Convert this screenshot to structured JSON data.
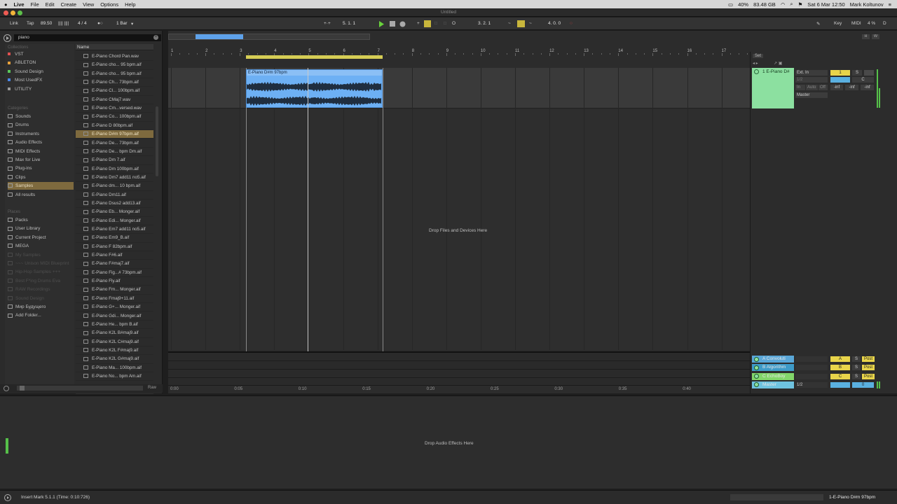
{
  "menubar": {
    "items": [
      "Live",
      "File",
      "Edit",
      "Create",
      "View",
      "Options",
      "Help"
    ],
    "battery": "40%",
    "disk": "83.48 GB",
    "clock": "Sat 6 Mar 12:50",
    "user": "Mark Koltunov"
  },
  "window": {
    "title": "Untitled"
  },
  "control": {
    "link": "Link",
    "tap": "Tap",
    "tempo": "89.50",
    "signature": "4 / 4",
    "quantize": "1 Bar",
    "position": "5. 1. 1",
    "loop_start": "3. 2. 1",
    "loop_length": "4. 0. 0",
    "key": "Key",
    "midi": "MIDI",
    "cpu": "4 %",
    "disk_indicator": "D"
  },
  "browser": {
    "search": "piano",
    "collections_header": "Collections",
    "collections": [
      {
        "label": "VST",
        "color": "#e05050"
      },
      {
        "label": "ABLETON",
        "color": "#e8a23a"
      },
      {
        "label": "Sound Design",
        "color": "#5ac85a"
      },
      {
        "label": "Most UsedFX",
        "color": "#4a86e8"
      },
      {
        "label": "UTILITY",
        "color": "#9a9a9a"
      }
    ],
    "categories_header": "Categories",
    "categories": [
      "Sounds",
      "Drums",
      "Instruments",
      "Audio Effects",
      "MIDI Effects",
      "Max for Live",
      "Plug-ins",
      "Clips",
      "Samples",
      "All results"
    ],
    "selected_category": "Samples",
    "places_header": "Places",
    "places": [
      {
        "label": "Packs",
        "dim": false
      },
      {
        "label": "User Library",
        "dim": false
      },
      {
        "label": "Current Project",
        "dim": false
      },
      {
        "label": "MEGA",
        "dim": false
      },
      {
        "label": "My Samples",
        "dim": true
      },
      {
        "label": "~~~ Unison MIDI Blueprint",
        "dim": true
      },
      {
        "label": "Hip-Hop Samples +++",
        "dim": true
      },
      {
        "label": "Best F*ing Drums Eva",
        "dim": true
      },
      {
        "label": "RAW Recordings",
        "dim": true
      },
      {
        "label": "Sound Design",
        "dim": true
      },
      {
        "label": "Мир Будущего",
        "dim": false
      },
      {
        "label": "Add Folder...",
        "dim": false
      }
    ],
    "name_header": "Name",
    "files": [
      "E-Piano Chord Pan.wav",
      "E-Piano cho... 95 bpm.aif",
      "E-Piano cho... 95 bpm.aif",
      "E-Piano Ch... 73bpm.aif",
      "E-Piano Cl... 100bpm.aif",
      "E-Piano CMaj7.wav",
      "E-Piano Cm...versed.wav",
      "E-Piano Co... 100bpm.aif",
      "E-Piano D 80bpm.aif",
      "E-Piano D#m 97bpm.aif",
      "E-Piano De... 73bpm.aif",
      "E-Piano De... bpm Dm.aif",
      "E-Piano Dm 7.aif",
      "E-Piano Dm 100bpm.aif",
      "E-Piano Dm7 add11 no5.aif",
      "E-Piano dm... 10 bpm.aif",
      "E-Piano Dm11.aif",
      "E-Piano Dsus2 add13.aif",
      "E-Piano Eb... Monger.aif",
      "E-Piano Edi... Monger.aif",
      "E-Piano Em7 add11 no5.aif",
      "E-Piano Em9_B.aif",
      "E-Piano F 82bpm.aif",
      "E-Piano F#6.aif",
      "E-Piano F#maj7.aif",
      "E-Piano Fig...# 73bpm.aif",
      "E-Piano Fly.aif",
      "E-Piano Fm... Monger.aif",
      "E-Piano Fmaj9+11.aif",
      "E-Piano G+... Monger.aif",
      "E-Piano Gdi... Monger.aif",
      "E-Piano He... bpm B.aif",
      "E-Piano K2L B#maj9.aif",
      "E-Piano K2L C#maj9.aif",
      "E-Piano K2L F#maj9.aif",
      "E-Piano K2L G#maj9.aif",
      "E-Piano Ma... 100bpm.aif",
      "E-Piano No... bpm Am.aif"
    ],
    "selected_file": "E-Piano D#m 97bpm.aif",
    "raw": "Raw"
  },
  "arrangement": {
    "bar_numbers": [
      "1",
      "2",
      "3",
      "4",
      "5",
      "6",
      "7",
      "8",
      "9",
      "10",
      "11",
      "12",
      "13",
      "14",
      "15",
      "16",
      "17"
    ],
    "clip_name": "E-Piano D#m 97bpm",
    "drop_files": "Drop Files and Devices Here",
    "time_labels": [
      "0:00",
      "0:05",
      "0:10",
      "0:15",
      "0:20",
      "0:25",
      "0:30",
      "0:35",
      "0:40"
    ]
  },
  "mixer": {
    "set": "Set",
    "track_name": "1 E-Piano D#",
    "input": "Ext. In",
    "input_ch": "1/2",
    "monitor": [
      "In",
      "Auto",
      "Off"
    ],
    "output": "Master",
    "track_number": "1",
    "solo": "S",
    "pan": "C",
    "vol_readouts": [
      "-inf",
      "-inf",
      "-inf"
    ],
    "returns": [
      {
        "name": "A Convoluti",
        "letter": "A",
        "color": "#5aa7d8"
      },
      {
        "name": "B Algorithm",
        "letter": "B",
        "color": "#3e9bc9"
      },
      {
        "name": "C EchoBoy",
        "letter": "C",
        "color": "#82d66a"
      },
      {
        "name": "Master",
        "letter": "",
        "color": "#6fc3e0"
      }
    ],
    "post": "Post",
    "master_out": "1/2",
    "master_zero": "0"
  },
  "detail": {
    "drop_fx": "Drop Audio Effects Here"
  },
  "status": {
    "message": "Insert Mark 5.1.1 (Time: 0:10:726)",
    "clip": "1-E-Piano D#m 97bpm"
  }
}
